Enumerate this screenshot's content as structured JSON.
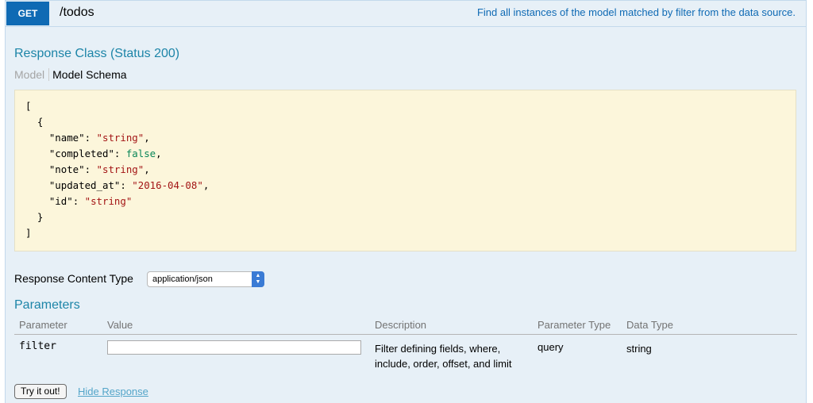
{
  "operation": {
    "method": "GET",
    "path": "/todos",
    "summary": "Find all instances of the model matched by filter from the data source."
  },
  "response_class": {
    "title": "Response Class (Status 200)",
    "tabs": {
      "model": "Model",
      "model_schema": "Model Schema"
    },
    "schema": {
      "open_bracket": "[",
      "open_brace": "  {",
      "fields": [
        {
          "key": "\"name\"",
          "value": "\"string\"",
          "type": "string",
          "comma": ","
        },
        {
          "key": "\"completed\"",
          "value": "false",
          "type": "boolean",
          "comma": ","
        },
        {
          "key": "\"note\"",
          "value": "\"string\"",
          "type": "string",
          "comma": ","
        },
        {
          "key": "\"updated_at\"",
          "value": "\"2016-04-08\"",
          "type": "string",
          "comma": ","
        },
        {
          "key": "\"id\"",
          "value": "\"string\"",
          "type": "string",
          "comma": ""
        }
      ],
      "close_brace": "  }",
      "close_bracket": "]"
    }
  },
  "response_content_type": {
    "label": "Response Content Type",
    "selected": "application/json"
  },
  "parameters": {
    "title": "Parameters",
    "headers": {
      "parameter": "Parameter",
      "value": "Value",
      "description": "Description",
      "parameter_type": "Parameter Type",
      "data_type": "Data Type"
    },
    "rows": [
      {
        "name": "filter",
        "value": "",
        "description": "Filter defining fields, where, include, order, offset, and limit",
        "parameter_type": "query",
        "data_type": "string"
      }
    ]
  },
  "actions": {
    "try_label": "Try it out!",
    "hide_label": "Hide Response"
  },
  "colors": {
    "method_bg": "#0f6ab4",
    "panel_bg": "#e7f0f7",
    "section_title": "#1d85a8",
    "schema_bg": "#fcf6db",
    "json_string": "#a31515",
    "json_boolean": "#098658"
  }
}
